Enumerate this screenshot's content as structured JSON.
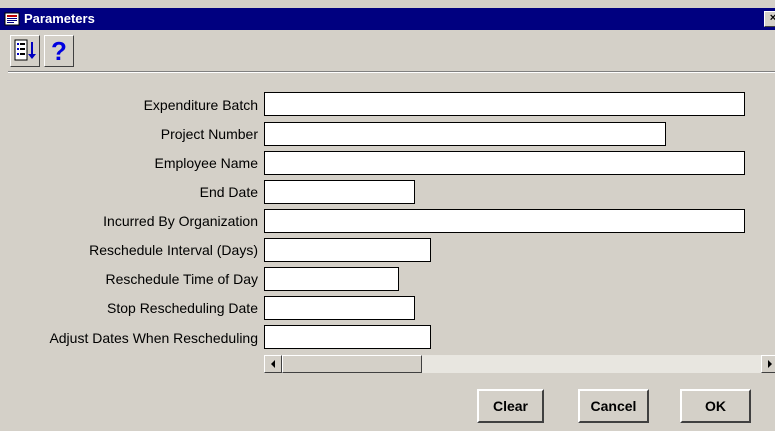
{
  "window": {
    "title": "Parameters",
    "close_label": "×"
  },
  "toolbar": {
    "list_icon": "list-values-icon",
    "help_label": "?",
    "help_icon": "help-icon"
  },
  "fields": {
    "expenditure_batch": {
      "label": "Expenditure Batch",
      "value": ""
    },
    "project_number": {
      "label": "Project Number",
      "value": ""
    },
    "employee_name": {
      "label": "Employee Name",
      "value": ""
    },
    "end_date": {
      "label": "End Date",
      "value": ""
    },
    "incurred_by_organization": {
      "label": "Incurred By Organization",
      "value": ""
    },
    "reschedule_interval": {
      "label": "Reschedule Interval (Days)",
      "value": ""
    },
    "reschedule_time_of_day": {
      "label": "Reschedule Time of Day",
      "value": ""
    },
    "stop_rescheduling_date": {
      "label": "Stop Rescheduling Date",
      "value": ""
    },
    "adjust_dates": {
      "label": "Adjust Dates When Rescheduling",
      "value": ""
    }
  },
  "buttons": {
    "clear": "Clear",
    "cancel": "Cancel",
    "ok": "OK"
  }
}
